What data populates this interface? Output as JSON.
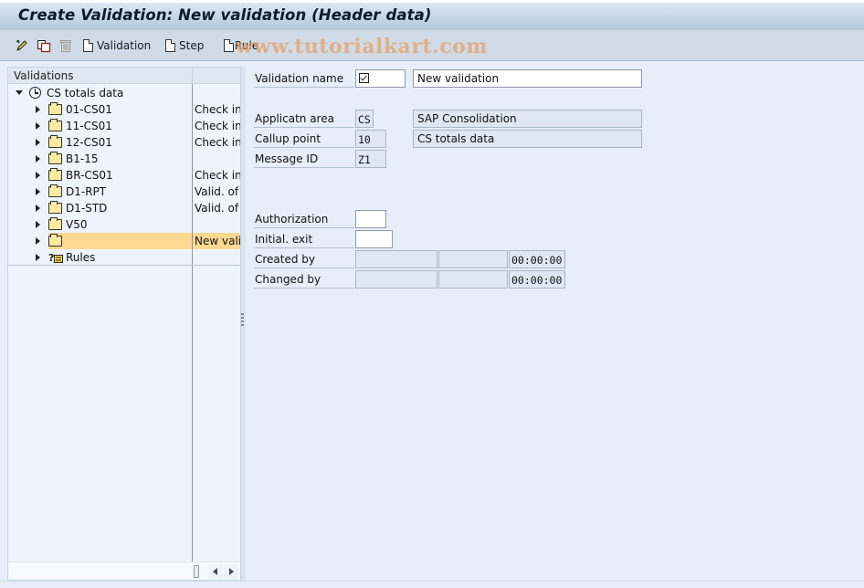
{
  "window": {
    "title": "Create Validation: New validation (Header data)"
  },
  "toolbar": {
    "icons": [
      "edit-pencil-icon",
      "copy-icon",
      "delete-trash-icon"
    ],
    "buttons": [
      {
        "label": "Validation",
        "icon": "new-document-icon"
      },
      {
        "label": "Step",
        "icon": "new-document-icon"
      },
      {
        "label": "Rule",
        "icon": "new-document-icon"
      }
    ]
  },
  "watermark": "www.tutorialkart.com",
  "tree": {
    "header": "Validations",
    "root": {
      "label": "CS totals data",
      "icon": "clock-icon",
      "expanded": true
    },
    "items": [
      {
        "name": "01-CS01",
        "desc": "Check inc",
        "icon": "folder-icon",
        "selected": false
      },
      {
        "name": "11-CS01",
        "desc": "Check inc",
        "icon": "folder-icon",
        "selected": false
      },
      {
        "name": "12-CS01",
        "desc": "Check inc",
        "icon": "folder-icon",
        "selected": false
      },
      {
        "name": "B1-15",
        "desc": "",
        "icon": "folder-icon",
        "selected": false
      },
      {
        "name": "BR-CS01",
        "desc": "Check inc",
        "icon": "folder-icon",
        "selected": false
      },
      {
        "name": "D1-RPT",
        "desc": "Valid. of I",
        "icon": "folder-icon",
        "selected": false
      },
      {
        "name": "D1-STD",
        "desc": "Valid. of S",
        "icon": "folder-icon",
        "selected": false
      },
      {
        "name": "V50",
        "desc": "",
        "icon": "folder-icon",
        "selected": false
      },
      {
        "name": "",
        "desc": "New valid",
        "icon": "folder-icon",
        "selected": true
      },
      {
        "name": "Rules",
        "desc": "",
        "icon": "rules-icon",
        "selected": false
      }
    ]
  },
  "form": {
    "validation_name": {
      "label": "Validation name",
      "value": "",
      "description": "New validation"
    },
    "application_area": {
      "label": "Applicatn area",
      "value": "CS",
      "description": "SAP Consolidation"
    },
    "callup_point": {
      "label": "Callup point",
      "value": "10",
      "description": "CS totals data"
    },
    "message_id": {
      "label": "Message ID",
      "value": "Z1"
    },
    "authorization": {
      "label": "Authorization",
      "value": ""
    },
    "initial_exit": {
      "label": "Initial. exit",
      "value": ""
    },
    "created_by": {
      "label": "Created by",
      "user": "",
      "date": "",
      "time": "00:00:00"
    },
    "changed_by": {
      "label": "Changed by",
      "user": "",
      "date": "",
      "time": "00:00:00"
    }
  }
}
